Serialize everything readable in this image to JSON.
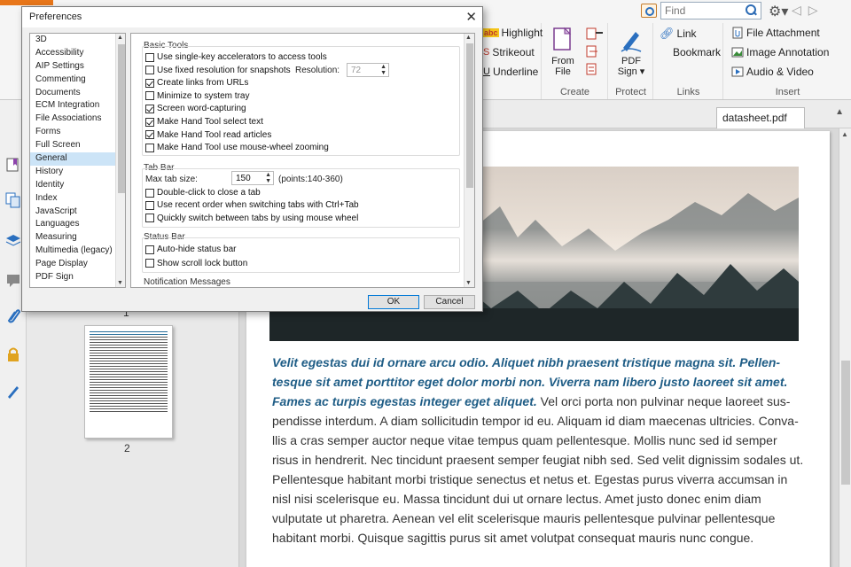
{
  "find": {
    "placeholder": "Find"
  },
  "ribbon": {
    "comment": [
      {
        "label": "Highlight",
        "icon": "highlight-icon"
      },
      {
        "label": "Strikeout",
        "icon": "strikeout-icon"
      },
      {
        "label": "Underline",
        "icon": "underline-icon"
      }
    ],
    "create": {
      "from_file_line1": "From",
      "from_file_line2": "File",
      "group": "Create"
    },
    "protect": {
      "pdf_sign_line1": "PDF",
      "pdf_sign_line2": "Sign ▾",
      "group": "Protect"
    },
    "links": {
      "link": "Link",
      "bookmark": "Bookmark",
      "group": "Links"
    },
    "insert": {
      "file_attachment": "File Attachment",
      "image_annotation": "Image Annotation",
      "audio_video": "Audio & Video",
      "group": "Insert"
    }
  },
  "thumbnails": {
    "page1_label": "1",
    "page2_label": "2"
  },
  "document": {
    "tab_title": "datasheet.pdf",
    "lead": "Velit egestas dui id ornare arcu odio. Aliquet nibh praesent tristique magna sit. Pellen- tesque sit amet porttitor eget dolor morbi non. Viverra nam libero justo laoreet sit amet. Fames ac turpis egestas integer eget aliquet.",
    "body": " Vel orci porta non pulvinar neque laoreet sus- pendisse interdum. A diam sollicitudin tempor id eu. Aliquam id diam maecenas ultricies. Conva- llis a cras semper auctor neque vitae tempus quam pellentesque. Mollis nunc sed id semper risus in hendrerit. Nec tincidunt praesent semper feugiat nibh sed. Sed velit dignissim sodales ut. Pellentesque habitant morbi tristique senectus et netus et. Egestas purus viverra accumsan in nisl nisi scelerisque eu. Massa tincidunt dui ut ornare lectus. Amet justo donec enim diam vulputate ut pharetra. Aenean vel elit scelerisque mauris pellentesque pulvinar pellentesque habitant morbi. Quisque sagittis purus sit amet volutpat consequat mauris nunc congue."
  },
  "dialog": {
    "title": "Preferences",
    "categories": [
      "3D",
      "Accessibility",
      "AIP Settings",
      "Commenting",
      "Documents",
      "ECM Integration",
      "File Associations",
      "Forms",
      "Full Screen",
      "General",
      "History",
      "Identity",
      "Index",
      "JavaScript",
      "Languages",
      "Measuring",
      "Multimedia (legacy)",
      "Page Display",
      "PDF Sign"
    ],
    "selected_category": "General",
    "basic_tools": {
      "title": "Basic Tools",
      "options": [
        {
          "label": "Use single-key accelerators to access tools",
          "checked": false
        },
        {
          "label": "Use fixed resolution for snapshots",
          "checked": false
        },
        {
          "label": "Create links from URLs",
          "checked": true
        },
        {
          "label": "Minimize to system tray",
          "checked": false
        },
        {
          "label": "Screen word-capturing",
          "checked": true
        },
        {
          "label": "Make Hand Tool select text",
          "checked": true
        },
        {
          "label": "Make Hand Tool read articles",
          "checked": true
        },
        {
          "label": "Make Hand Tool use mouse-wheel zooming",
          "checked": false
        }
      ],
      "resolution_label": "Resolution:",
      "resolution_value": "72"
    },
    "tab_bar": {
      "title": "Tab Bar",
      "max_tab_label": "Max tab size:",
      "max_tab_value": "150",
      "points_hint": "(points:140-360)",
      "options": [
        {
          "label": "Double-click to close a tab",
          "checked": false
        },
        {
          "label": "Use recent order when switching tabs with Ctrl+Tab",
          "checked": false
        },
        {
          "label": "Quickly switch between tabs by using mouse wheel",
          "checked": false
        }
      ]
    },
    "status_bar": {
      "title": "Status Bar",
      "options": [
        {
          "label": "Auto-hide status bar",
          "checked": false
        },
        {
          "label": "Show scroll lock button",
          "checked": false
        }
      ]
    },
    "notification_title": "Notification Messages",
    "ok": "OK",
    "cancel": "Cancel"
  }
}
